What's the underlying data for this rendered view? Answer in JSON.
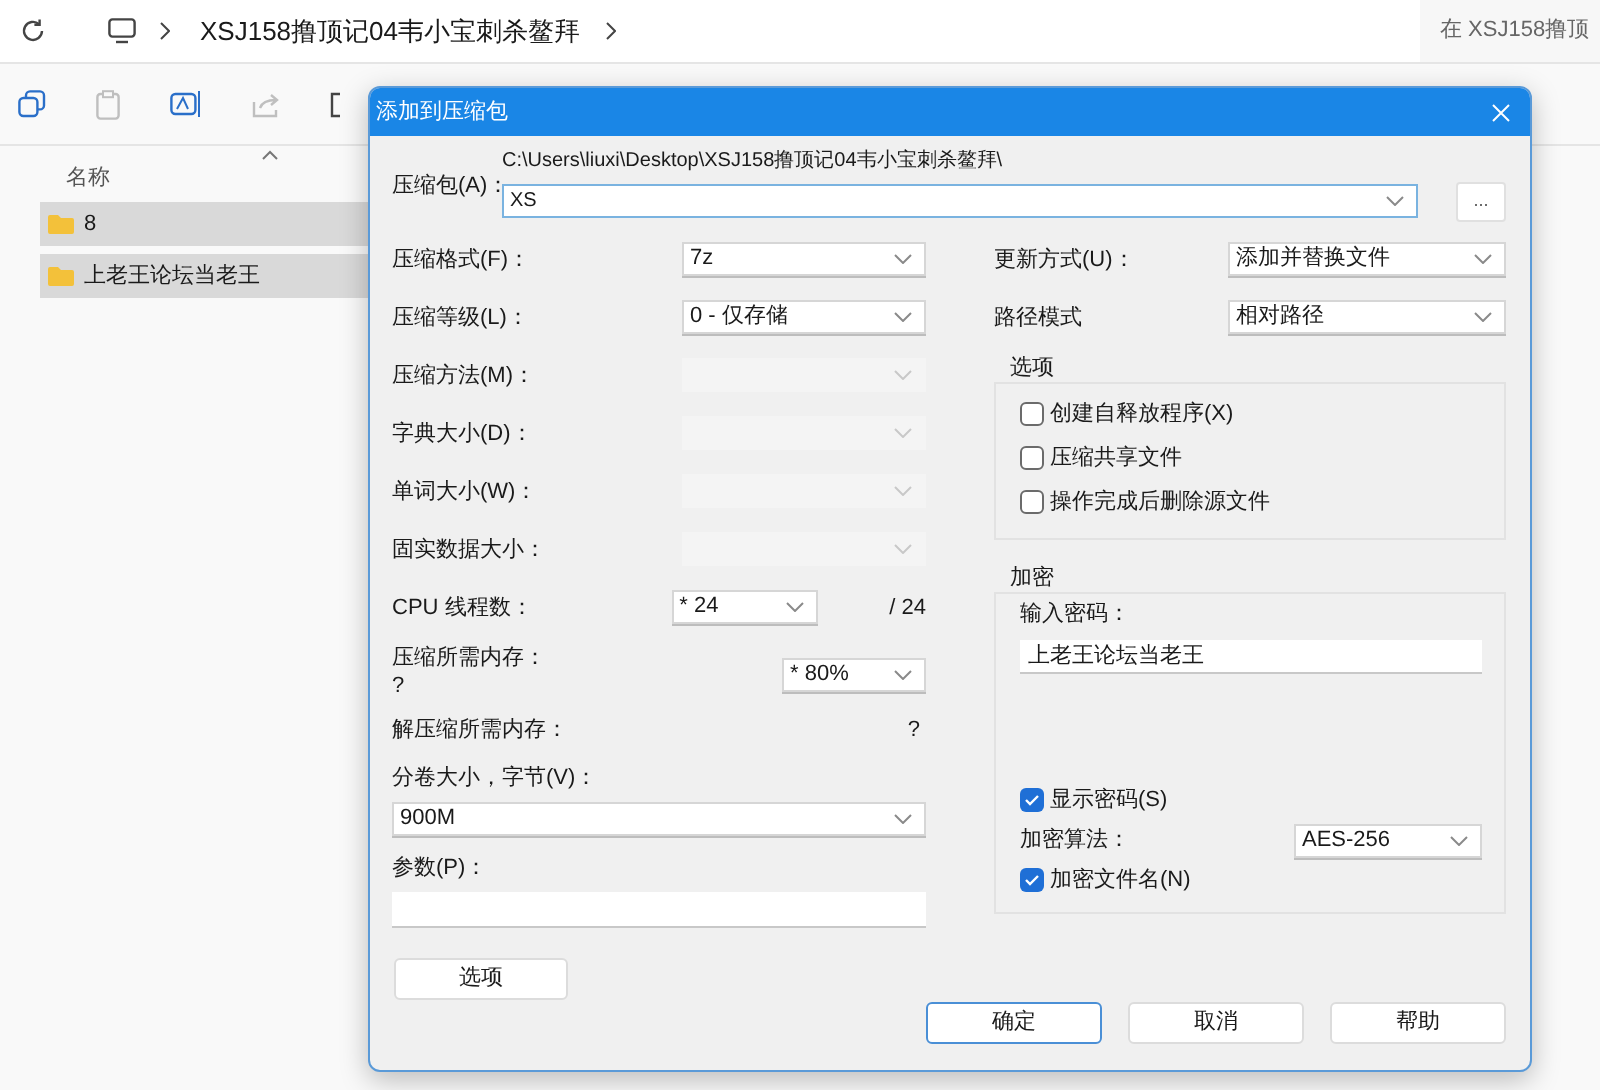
{
  "explorer": {
    "breadcrumb": "XSJ158撸顶记04韦小宝刺杀鳌拜",
    "search_placeholder": "在 XSJ158撸顶",
    "column_header": "名称",
    "files": [
      {
        "name": "8",
        "selected": true
      },
      {
        "name": "上老王论坛当老王",
        "selected": true
      }
    ]
  },
  "dialog": {
    "title": "添加到压缩包",
    "archive": {
      "label": "压缩包(A)：",
      "path": "C:\\Users\\liuxi\\Desktop\\XSJ158撸顶记04韦小宝刺杀鳌拜\\",
      "value": "XS",
      "browse": "..."
    },
    "left_fields": [
      {
        "kind": "select",
        "label": "压缩格式(F)：",
        "value": "7z",
        "disabled": false
      },
      {
        "kind": "select",
        "label": "压缩等级(L)：",
        "value": "0 - 仅存储",
        "disabled": false
      },
      {
        "kind": "select",
        "label": "压缩方法(M)：",
        "disabled": true
      },
      {
        "kind": "select",
        "label": "字典大小(D)：",
        "disabled": true
      },
      {
        "kind": "select",
        "label": "单词大小(W)：",
        "disabled": true
      },
      {
        "kind": "select",
        "label": "固实数据大小：",
        "disabled": true
      },
      {
        "kind": "threads",
        "label": "CPU 线程数：",
        "value": "* 24",
        "suffix": "/ 24",
        "disabled": false
      },
      {
        "kind": "memory",
        "label": "压缩所需内存：",
        "reading": "?",
        "value": "* 80%",
        "disabled": false
      },
      {
        "kind": "info",
        "label": "解压缩所需内存：",
        "reading": "?"
      },
      {
        "kind": "wide-select",
        "label": "分卷大小，字节(V)：",
        "value": "900M",
        "disabled": false
      },
      {
        "kind": "wide-input",
        "label": "参数(P)："
      }
    ],
    "options_button": "选项",
    "right_fields": [
      {
        "label": "更新方式(U)：",
        "value": "添加并替换文件"
      },
      {
        "label": "路径模式",
        "value": "相对路径"
      }
    ],
    "options_group": {
      "title": "选项",
      "checkboxes": [
        {
          "label": "创建自释放程序(X)",
          "checked": false
        },
        {
          "label": "压缩共享文件",
          "checked": false
        },
        {
          "label": "操作完成后删除源文件",
          "checked": false
        }
      ]
    },
    "encryption": {
      "title": "加密",
      "password_label": "输入密码：",
      "password": "上老王论坛当老王",
      "show_password": {
        "label": "显示密码(S)",
        "checked": true
      },
      "method": {
        "label": "加密算法：",
        "value": "AES-256"
      },
      "encrypt_names": {
        "label": "加密文件名(N)",
        "checked": true
      }
    },
    "buttons": [
      {
        "label": "确定",
        "focused": true
      },
      {
        "label": "取消",
        "focused": false
      },
      {
        "label": "帮助",
        "focused": false
      }
    ]
  }
}
